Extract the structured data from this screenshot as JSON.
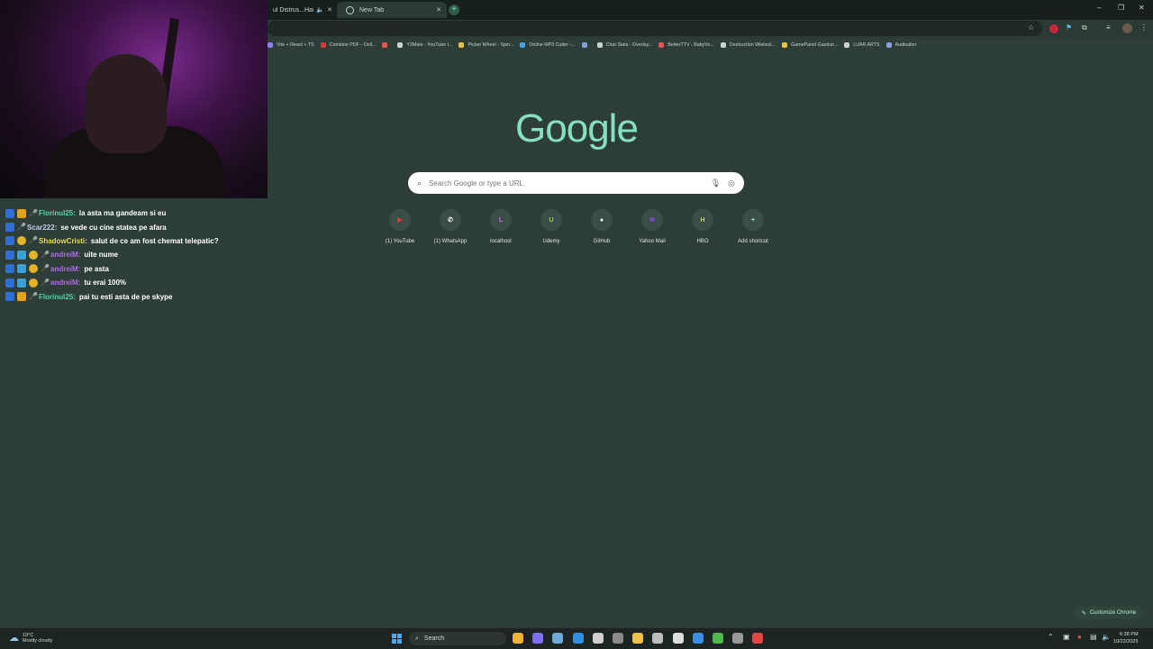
{
  "browser": {
    "tabs": [
      {
        "title": "ul Distrus...Hai mu",
        "active": false,
        "icons": [
          "speaker-icon",
          "close-icon"
        ]
      },
      {
        "title": "New Tab",
        "active": true,
        "icons": [
          "close-icon"
        ]
      }
    ],
    "new_tab_symbol": "+",
    "window_controls": {
      "minimize": "–",
      "restore": "❐",
      "close": "✕"
    }
  },
  "bookmarks": [
    {
      "label": "Vite + React + TS",
      "color": "#8e7cf0"
    },
    {
      "label": "Combine PDF - Onli...",
      "color": "#d23b3b"
    },
    {
      "label": "",
      "color": "#e25555"
    },
    {
      "label": "Y2Mate - YouTube t...",
      "color": "#c9d2ce"
    },
    {
      "label": "Picker Wheel - Spin...",
      "color": "#e6c347"
    },
    {
      "label": "Online MP3 Cutter -...",
      "color": "#4aa0e6"
    },
    {
      "label": "",
      "color": "#8aa0d8"
    },
    {
      "label": "Chat Stats - Overlay...",
      "color": "#c9d2ce"
    },
    {
      "label": "BetterTTV - BabyVo...",
      "color": "#e25555"
    },
    {
      "label": "Destruction Wielock...",
      "color": "#c9d2ce"
    },
    {
      "label": "GamePanel Gazduir...",
      "color": "#e6c347"
    },
    {
      "label": "LUAR ARTS",
      "color": "#c9d2ce"
    },
    {
      "label": "Audioalter",
      "color": "#8aa0d8"
    }
  ],
  "chat": [
    {
      "user": "Florinul25:",
      "color": "#4fd6a4",
      "message": "la asta ma gandeam si eu",
      "badges": [
        "sword",
        "crown",
        "mic"
      ]
    },
    {
      "user": "Scar222:",
      "color": "#c9cde6",
      "message": "se vede cu cine statea pe afara",
      "badges": [
        "sword",
        "mic"
      ]
    },
    {
      "user": "ShadowCristi:",
      "color": "#e8d95a",
      "message": "salut de ce am fost chemat telepatic?",
      "badges": [
        "sword",
        "coin",
        "mic"
      ]
    },
    {
      "user": "andreiM:",
      "color": "#b06ce6",
      "message": "uite nume",
      "badges": [
        "sword",
        "grid",
        "coin",
        "mic"
      ]
    },
    {
      "user": "andreiM:",
      "color": "#b06ce6",
      "message": "pe asta",
      "badges": [
        "sword",
        "grid",
        "coin",
        "mic"
      ]
    },
    {
      "user": "andreiM:",
      "color": "#b06ce6",
      "message": "tu erai 100%",
      "badges": [
        "sword",
        "grid",
        "coin",
        "mic"
      ]
    },
    {
      "user": "Florinul25:",
      "color": "#4fd6a4",
      "message": "pai tu esti asta de pe skype",
      "badges": [
        "sword",
        "crown",
        "mic"
      ]
    }
  ],
  "ntp": {
    "logo": "Google",
    "search_placeholder": "Search Google or type a URL",
    "shortcuts": [
      {
        "label": "(1) YouTube",
        "glyph": "▶",
        "color": "#e53935"
      },
      {
        "label": "(1) WhatsApp",
        "glyph": "✆",
        "color": "#ffffff"
      },
      {
        "label": "localhost",
        "glyph": "L",
        "color": "#d06ad8"
      },
      {
        "label": "Udemy",
        "glyph": "U",
        "color": "#9ad35a"
      },
      {
        "label": "GitHub",
        "glyph": "●",
        "color": "#ffffff"
      },
      {
        "label": "Yahoo Mail",
        "glyph": "✉",
        "color": "#8a4ff0"
      },
      {
        "label": "HBO",
        "glyph": "H",
        "color": "#c8d26a"
      },
      {
        "label": "Add shortcut",
        "glyph": "+",
        "color": "#9fe8c4"
      }
    ],
    "customize_label": "Customize Chrome"
  },
  "taskbar": {
    "weather_temp": "19°C",
    "weather_desc": "Mostly cloudy",
    "search_label": "Search",
    "time": "6:38 PM",
    "date": "10/22/2025",
    "apps": [
      {
        "name": "chrome",
        "color": "#f2b233"
      },
      {
        "name": "discord",
        "color": "#7d6ff0"
      },
      {
        "name": "steam",
        "color": "#6fa9d8"
      },
      {
        "name": "vscode",
        "color": "#2f8fe0"
      },
      {
        "name": "app",
        "color": "#cfcfcf"
      },
      {
        "name": "calculator",
        "color": "#8a8a8a"
      },
      {
        "name": "files",
        "color": "#f0c24a"
      },
      {
        "name": "app",
        "color": "#bdbdbd"
      },
      {
        "name": "app",
        "color": "#dedede"
      },
      {
        "name": "app",
        "color": "#3b8fe0"
      },
      {
        "name": "xbox",
        "color": "#4fb84f"
      },
      {
        "name": "app",
        "color": "#9a9a9a"
      },
      {
        "name": "app",
        "color": "#e04646"
      }
    ]
  }
}
